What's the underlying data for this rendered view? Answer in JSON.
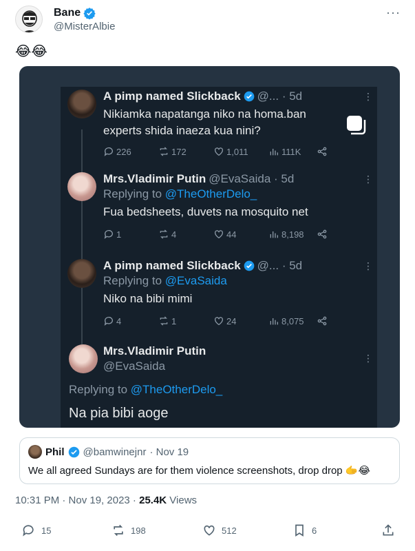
{
  "tweet": {
    "author_name": "Bane",
    "author_handle": "@MisterAlbie",
    "more": "···",
    "text": "😂😂",
    "timestamp": "10:31 PM · Nov 19, 2023 · ",
    "views_count": "25.4K",
    "views_label": " Views"
  },
  "screenshot": {
    "posts": [
      {
        "name": "A pimp named Slickback",
        "meta": "@... · 5d",
        "lines": [
          "Nikiamka napatanga niko na homa.ban",
          "experts shida inaeza kua nini?"
        ],
        "replies": "226",
        "retweets": "172",
        "likes": "1,011",
        "views": "111K"
      },
      {
        "name": "Mrs.Vladimir Putin",
        "meta": "@EvaSaida · 5d",
        "reply_prefix": "Replying to ",
        "reply_to": "@TheOtherDelo_",
        "lines": [
          "Fua bedsheets, duvets na mosquito net"
        ],
        "replies": "1",
        "retweets": "4",
        "likes": "44",
        "views": "8,198"
      },
      {
        "name": "A pimp named Slickback",
        "meta": "@... · 5d",
        "reply_prefix": "Replying to ",
        "reply_to": "@EvaSaida",
        "lines": [
          "Niko na bibi mimi"
        ],
        "replies": "4",
        "retweets": "1",
        "likes": "24",
        "views": "8,075"
      },
      {
        "name": "Mrs.Vladimir Putin",
        "handle": "@EvaSaida",
        "reply_prefix": "Replying to ",
        "reply_to": "@TheOtherDelo_",
        "lines": [
          "Na pia bibi aoge"
        ]
      }
    ]
  },
  "quote": {
    "name": "Phil",
    "handle": "@bamwinejnr",
    "date": " · Nov 19",
    "text": "We all agreed Sundays are for them violence screenshots, drop drop 🫱😂"
  },
  "actions": {
    "replies": "15",
    "retweets": "198",
    "likes": "512",
    "bookmarks": "6"
  },
  "colors": {
    "verified": "#1d9bf0",
    "mention": "#1d9bf0",
    "dark_bg": "#15202b"
  }
}
